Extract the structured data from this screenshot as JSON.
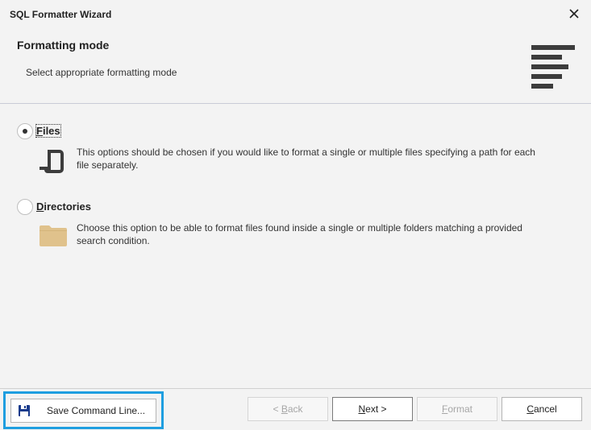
{
  "window": {
    "title": "SQL Formatter Wizard",
    "close_icon": "close-icon"
  },
  "header": {
    "title": "Formatting mode",
    "subtitle": "Select appropriate formatting mode",
    "icon": "formatting-lines-icon"
  },
  "options": [
    {
      "label_first": "F",
      "label_rest": "iles",
      "selected": true,
      "icon": "file-icon",
      "description_line1": "This options should be chosen if you would like to format a single or multiple files specifying a path for each",
      "description_line2": "file separately."
    },
    {
      "label_first": "D",
      "label_rest": "irectories",
      "selected": false,
      "icon": "folder-icon",
      "description_line1": "Choose this option to be able to format files found inside a single or multiple folders matching a provided",
      "description_line2": "search condition."
    }
  ],
  "footer": {
    "save_label": "Save Command Line...",
    "save_icon": "floppy-disk-icon",
    "back_label_prefix": "< ",
    "back_label_first": "B",
    "back_label_rest": "ack",
    "next_label_first": "N",
    "next_label_rest": "ext >",
    "format_label_first": "F",
    "format_label_rest": "ormat",
    "cancel_label_first": "C",
    "cancel_label_rest": "ancel"
  },
  "colors": {
    "highlight_border": "#1e9ee0",
    "folder": "#e0c28c",
    "icon_dark": "#3c3c3c",
    "floppy": "#1a3b8c"
  }
}
